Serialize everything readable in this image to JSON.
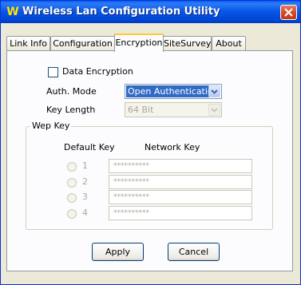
{
  "window": {
    "title": "Wireless Lan Configuration Utility",
    "app_icon_glyph": "W"
  },
  "tabs": [
    {
      "label": "Link Info",
      "active": false
    },
    {
      "label": "Configuration",
      "active": false
    },
    {
      "label": "Encryption",
      "active": true
    },
    {
      "label": "SiteSurvey",
      "active": false
    },
    {
      "label": "About",
      "active": false
    }
  ],
  "encryption": {
    "data_encryption_label": "Data Encryption",
    "data_encryption_checked": false,
    "auth_mode_label": "Auth. Mode",
    "auth_mode_value": "Open Authentication",
    "key_length_label": "Key Length",
    "key_length_value": "64 Bit"
  },
  "wep_key": {
    "group_label": "Wep Key",
    "default_key_header": "Default Key",
    "network_key_header": "Network Key",
    "keys": [
      {
        "index": "1",
        "value": "**********"
      },
      {
        "index": "2",
        "value": "**********"
      },
      {
        "index": "3",
        "value": "**********"
      },
      {
        "index": "4",
        "value": "**********"
      }
    ]
  },
  "buttons": {
    "apply": "Apply",
    "cancel": "Cancel"
  },
  "colors": {
    "title_bar": "#0a58e6",
    "dialog_face": "#ece9d8",
    "selection": "#316ac5",
    "active_tab_highlight": "#ffc83c"
  },
  "icons": {
    "app": "wireless-w-icon",
    "close": "close-icon",
    "dropdown": "chevron-down-icon"
  }
}
